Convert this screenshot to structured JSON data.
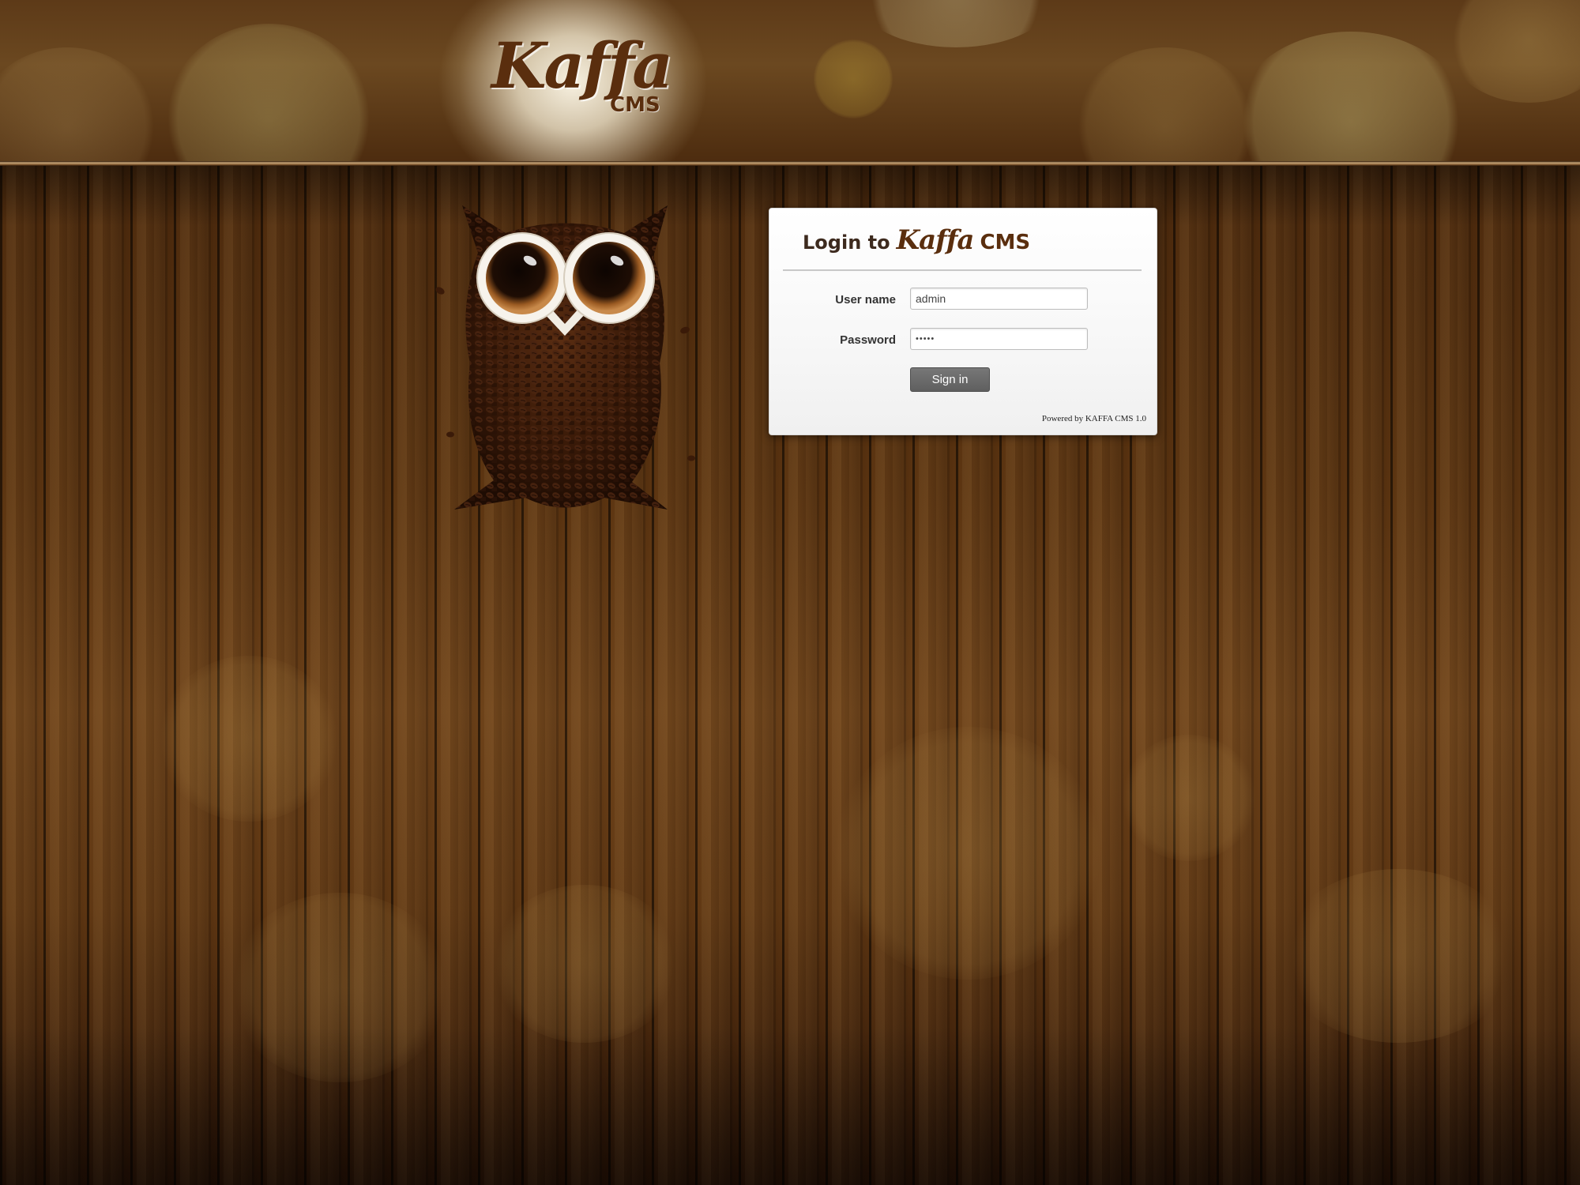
{
  "header": {
    "logo_main": "Kaffa",
    "logo_sub": "CMS"
  },
  "login": {
    "title_prefix": "Login to",
    "title_brand": "Kaffa",
    "title_suffix": "CMS",
    "username_label": "User name",
    "username_value": "admin",
    "password_label": "Password",
    "password_value": "•••••",
    "submit_label": "Sign in",
    "footer": "Powered by KAFFA CMS 1.0"
  },
  "colors": {
    "brand_brown": "#5a2e0e",
    "button_gray": "#666666",
    "wood_dark": "#4a280c"
  },
  "icons": {
    "mascot": "coffee-owl-icon"
  }
}
